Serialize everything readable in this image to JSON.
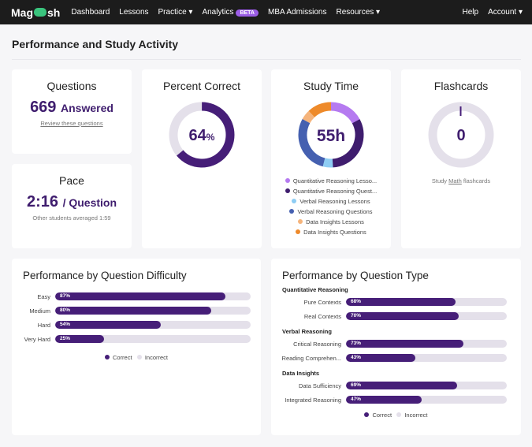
{
  "nav": {
    "logo": "Magoosh",
    "items": [
      "Dashboard",
      "Lessons",
      "Practice ▾",
      "Analytics",
      "MBA Admissions",
      "Resources ▾"
    ],
    "beta": "BETA",
    "right": [
      "Help",
      "Account ▾"
    ]
  },
  "page_title": "Performance and Study Activity",
  "questions": {
    "title": "Questions",
    "count": "669",
    "unit": "Answered",
    "link": "Review these questions"
  },
  "pace": {
    "title": "Pace",
    "value": "2:16",
    "unit": "/ Question",
    "note": "Other students averaged 1:59"
  },
  "percent_correct": {
    "title": "Percent Correct",
    "value": "64",
    "unit": "%",
    "fraction": 0.64
  },
  "study_time": {
    "title": "Study Time",
    "value": "55h",
    "segments": [
      {
        "label": "Quantitative Reasoning Lesso...",
        "share": 17,
        "color": "#b57af0"
      },
      {
        "label": "Quantitative Reasoning Quest...",
        "share": 32,
        "color": "#3f1d6e"
      },
      {
        "label": "Verbal Reasoning Lessons",
        "share": 5,
        "color": "#8ecdf4"
      },
      {
        "label": "Verbal Reasoning Questions",
        "share": 29,
        "color": "#4560b0"
      },
      {
        "label": "Data Insights Lessons",
        "share": 5,
        "color": "#f5b47c"
      },
      {
        "label": "Data Insights Questions",
        "share": 12,
        "color": "#ee8a2a"
      }
    ]
  },
  "flashcards": {
    "title": "Flashcards",
    "value": "0",
    "pre": "Study ",
    "link": "Math",
    "post": " flashcards"
  },
  "difficulty": {
    "title": "Performance by Question Difficulty",
    "rows": [
      {
        "label": "Easy",
        "pct": 87,
        "text": "87%"
      },
      {
        "label": "Medium",
        "pct": 80,
        "text": "80%"
      },
      {
        "label": "Hard",
        "pct": 54,
        "text": "54%"
      },
      {
        "label": "Very Hard",
        "pct": 25,
        "text": "25%"
      }
    ]
  },
  "types": {
    "title": "Performance by Question Type",
    "groups": [
      {
        "name": "Quantitative Reasoning",
        "rows": [
          {
            "label": "Pure Contexts",
            "pct": 68,
            "text": "68%"
          },
          {
            "label": "Real Contexts",
            "pct": 70,
            "text": "70%"
          }
        ]
      },
      {
        "name": "Verbal Reasoning",
        "rows": [
          {
            "label": "Critical Reasoning",
            "pct": 73,
            "text": "73%"
          },
          {
            "label": "Reading Comprehen...",
            "pct": 43,
            "text": "43%"
          }
        ]
      },
      {
        "name": "Data Insights",
        "rows": [
          {
            "label": "Data Sufficiency",
            "pct": 69,
            "text": "69%"
          },
          {
            "label": "Integrated Reasoning",
            "pct": 47,
            "text": "47%"
          }
        ]
      }
    ]
  },
  "legend": {
    "correct": "Correct",
    "incorrect": "Incorrect"
  },
  "colors": {
    "correct": "#461e78",
    "incorrect": "#e4e0ea",
    "accent": "#3f1d6e"
  }
}
